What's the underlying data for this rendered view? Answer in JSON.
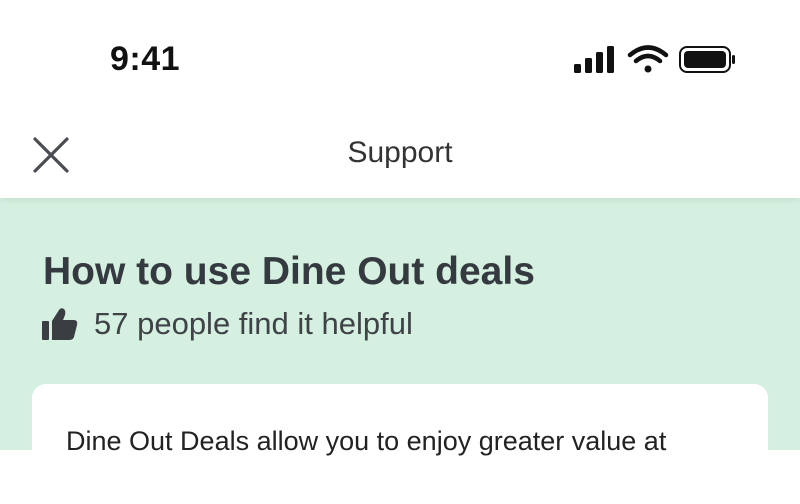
{
  "status_bar": {
    "time": "9:41",
    "icons": [
      "cellular-signal-icon",
      "wifi-icon",
      "battery-icon"
    ]
  },
  "header": {
    "title": "Support",
    "close_icon": "close-icon"
  },
  "article": {
    "title": "How to use Dine Out deals",
    "helpful_icon": "thumbs-up-icon",
    "helpful_text": "57 people find it helpful",
    "body_first_line": "Dine Out Deals allow you to enjoy greater value at"
  },
  "colors": {
    "content_background": "#d5f0e1",
    "card_background": "#ffffff",
    "title_text": "#353a40"
  }
}
